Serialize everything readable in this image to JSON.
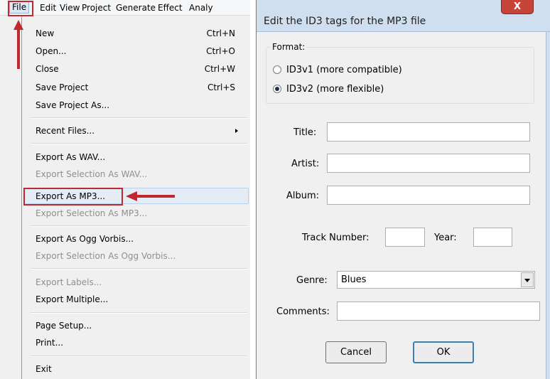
{
  "menubar": {
    "items": [
      "File",
      "Edit",
      "View",
      "Project",
      "Generate",
      "Effect",
      "Analy"
    ]
  },
  "file_menu": {
    "items": [
      {
        "label": "New",
        "shortcut": "Ctrl+N",
        "enabled": true
      },
      {
        "label": "Open...",
        "shortcut": "Ctrl+O",
        "enabled": true
      },
      {
        "label": "Close",
        "shortcut": "Ctrl+W",
        "enabled": true
      },
      {
        "label": "Save Project",
        "shortcut": "Ctrl+S",
        "enabled": true
      },
      {
        "label": "Save Project As...",
        "shortcut": "",
        "enabled": true
      },
      {
        "label": "Recent Files...",
        "shortcut": "",
        "enabled": true,
        "submenu": true
      },
      {
        "label": "Export As WAV...",
        "shortcut": "",
        "enabled": true
      },
      {
        "label": "Export Selection As WAV...",
        "shortcut": "",
        "enabled": false
      },
      {
        "label": "Export As MP3...",
        "shortcut": "",
        "enabled": true,
        "highlighted": true
      },
      {
        "label": "Export Selection As MP3...",
        "shortcut": "",
        "enabled": false
      },
      {
        "label": "Export As Ogg Vorbis...",
        "shortcut": "",
        "enabled": true
      },
      {
        "label": "Export Selection As Ogg Vorbis...",
        "shortcut": "",
        "enabled": false
      },
      {
        "label": "Export Labels...",
        "shortcut": "",
        "enabled": false
      },
      {
        "label": "Export Multiple...",
        "shortcut": "",
        "enabled": true
      },
      {
        "label": "Page Setup...",
        "shortcut": "",
        "enabled": true
      },
      {
        "label": "Print...",
        "shortcut": "",
        "enabled": true
      },
      {
        "label": "Exit",
        "shortcut": "",
        "enabled": true
      }
    ]
  },
  "dialog": {
    "title": "Edit the ID3 tags for the MP3 file",
    "close_glyph": "X",
    "format": {
      "legend": "Format:",
      "options": [
        {
          "label": "ID3v1 (more compatible)",
          "selected": false
        },
        {
          "label": "ID3v2 (more flexible)",
          "selected": true
        }
      ]
    },
    "fields": {
      "title_label": "Title:",
      "title_value": "",
      "artist_label": "Artist:",
      "artist_value": "",
      "album_label": "Album:",
      "album_value": "",
      "track_label": "Track Number:",
      "track_value": "",
      "year_label": "Year:",
      "year_value": "",
      "genre_label": "Genre:",
      "genre_value": "Blues",
      "comments_label": "Comments:",
      "comments_value": ""
    },
    "buttons": {
      "cancel": "Cancel",
      "ok": "OK"
    }
  },
  "colors": {
    "annotation_red": "#c0282d",
    "menu_bg": "#f0f0f0",
    "disabled_text": "#8f8f8f"
  }
}
